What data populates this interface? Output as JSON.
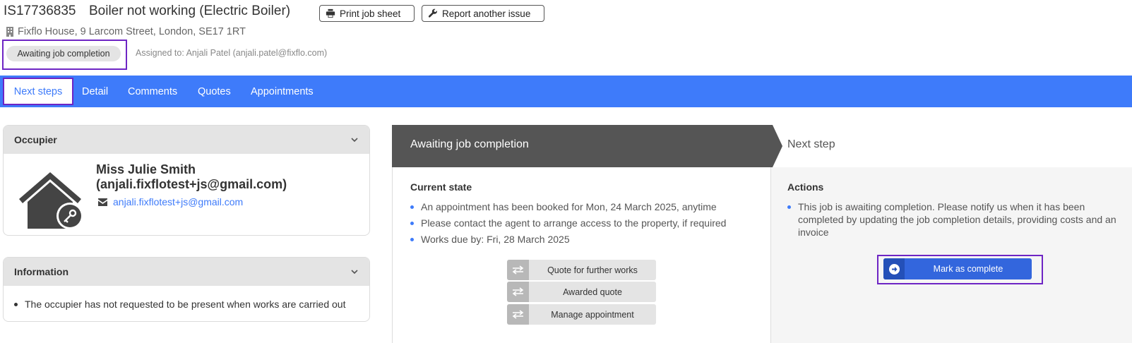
{
  "header": {
    "job_id": "IS17736835",
    "job_title": "Boiler not working (Electric Boiler)",
    "print_label": "Print job sheet",
    "report_label": "Report another issue",
    "address": "Fixflo House, 9 Larcom Street, London, SE17 1RT",
    "status": "Awaiting job completion",
    "assigned": "Assigned to: Anjali Patel (anjali.patel@fixflo.com)"
  },
  "tabs": [
    {
      "label": "Next steps",
      "active": true
    },
    {
      "label": "Detail"
    },
    {
      "label": "Comments"
    },
    {
      "label": "Quotes"
    },
    {
      "label": "Appointments"
    }
  ],
  "occupier": {
    "heading": "Occupier",
    "name_line1": "Miss Julie Smith",
    "name_line2": "(anjali.fixflotest+js@gmail.com)",
    "email": "anjali.fixflotest+js@gmail.com"
  },
  "information": {
    "heading": "Information",
    "text": "The occupier has not requested to be present when works are carried out"
  },
  "flow": {
    "current_title": "Awaiting job completion",
    "next_title": "Next step",
    "current_state_label": "Current state",
    "current_state_items": [
      "An appointment has been booked for Mon, 24 March 2025, anytime",
      "Please contact the agent to arrange access to the property, if required",
      "Works due by: Fri, 28 March 2025"
    ],
    "action_buttons": [
      "Quote for further works",
      "Awarded quote",
      "Manage appointment"
    ],
    "actions_label": "Actions",
    "actions_text": "This job is awaiting completion. Please notify us when it has been completed by updating the job completion details, providing costs and an invoice",
    "complete_label": "Mark as complete"
  },
  "colors": {
    "tabbar": "#3e7bfa",
    "highlight": "#6e25c4",
    "flow_dark": "#555555",
    "primary_button": "#3366dd"
  }
}
